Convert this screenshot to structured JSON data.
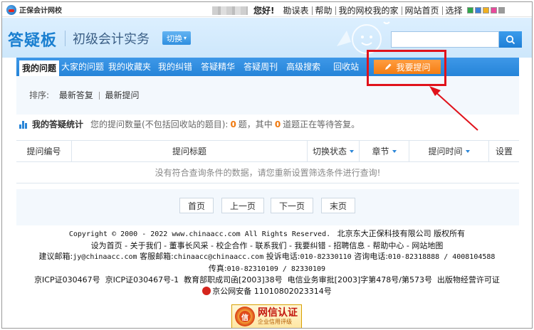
{
  "topbar": {
    "logo_text": "正保会计网校",
    "hello": "您好!",
    "links": [
      "勘误表",
      "帮助",
      "我的网校我的家",
      "网站首页",
      "选择"
    ],
    "swatch_colors": [
      "#2fa84a",
      "#3c7fd8",
      "#f0b020",
      "#e84a9c",
      "#9a9a9a"
    ]
  },
  "header": {
    "brand": "答疑板",
    "course": "初级会计实务",
    "switch_label": "切换",
    "search_placeholder": "",
    "search_icon": "search-icon"
  },
  "nav": {
    "items": [
      "我的问题",
      "大家的问题",
      "我的收藏夹",
      "我的纠错",
      "答疑精华",
      "答疑周刊",
      "高级搜索",
      "回收站"
    ],
    "active_index": 0,
    "ask_button": "我要提问",
    "ask_icon": "pencil-icon"
  },
  "sort": {
    "label": "排序:",
    "options": [
      "最新答复",
      "最新提问"
    ]
  },
  "stats": {
    "title": "我的答疑统计",
    "text_prefix": "您的提问数量(不包括回收站的题目):",
    "count": "0",
    "text_mid": "题，其中",
    "waiting": "0",
    "text_suffix": "道题正在等待答复。"
  },
  "table": {
    "headers": [
      "提问编号",
      "提问标题",
      "切换状态",
      "章节",
      "提问时间",
      "设置"
    ],
    "empty_message": "没有符合查询条件的数据，请您重新设置筛选条件进行查询!"
  },
  "pager": {
    "first": "首页",
    "prev": "上一页",
    "next": "下一页",
    "last": "末页"
  },
  "footer": {
    "copyright": "Copyright © 2000 - 2022 www.chinaacc.com All Rights Reserved.",
    "company": "北京东大正保科技有限公司 版权所有",
    "links_line": "设为首页 - 关于我们 - 董事长风采 - 校企合作 - 联系我们 - 我要纠错 - 招聘信息 - 帮助中心 - 网站地图",
    "contact_prefix": "建议邮箱:",
    "contact_email": "jy@chinaacc.com",
    "service_label": "客服邮箱:",
    "service_email": "chinaacc@chinaacc.com",
    "complaint_label": "投诉电话:",
    "complaint_phone": "010-82330110",
    "consult_label": "咨询电话:",
    "consult_phone": "010-82318888 / 4008104588",
    "fax_label": "传真:",
    "fax": "010-82310109 / 82330109",
    "license_line": "京ICP证030467号  京ICP证030467号-1  教育部职成司函[2003]38号  电信业务审批[2003]字第478号/第573号  出版物经营许可证",
    "police_record": "京公网安备 11010802023314号",
    "badge_title": "网信认证",
    "badge_sub": "企业信用评级",
    "badge_seal": "信"
  }
}
